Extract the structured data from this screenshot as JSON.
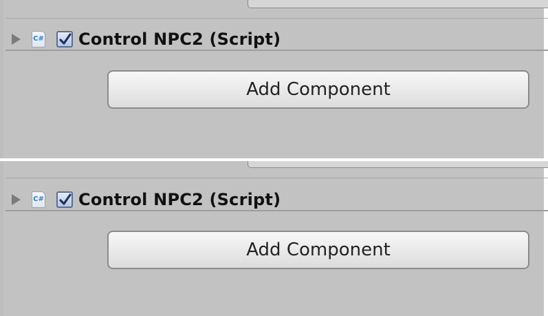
{
  "screens": [
    {
      "component": {
        "title": "Control NPC2 (Script)",
        "icon": "csharp-script-icon",
        "icon_text": "C#",
        "enabled": true,
        "checkbox_icon": "checkmark-icon"
      },
      "add_component_label": "Add Component"
    },
    {
      "component": {
        "title": "Control NPC2 (Script)",
        "icon": "csharp-script-icon",
        "icon_text": "C#",
        "enabled": true,
        "checkbox_icon": "checkmark-icon"
      },
      "add_component_label": "Add Component"
    }
  ],
  "colors": {
    "background": "#c2c2c2",
    "checkbox_check": "#1f2f66",
    "script_icon_text": "#2f7fd6"
  }
}
